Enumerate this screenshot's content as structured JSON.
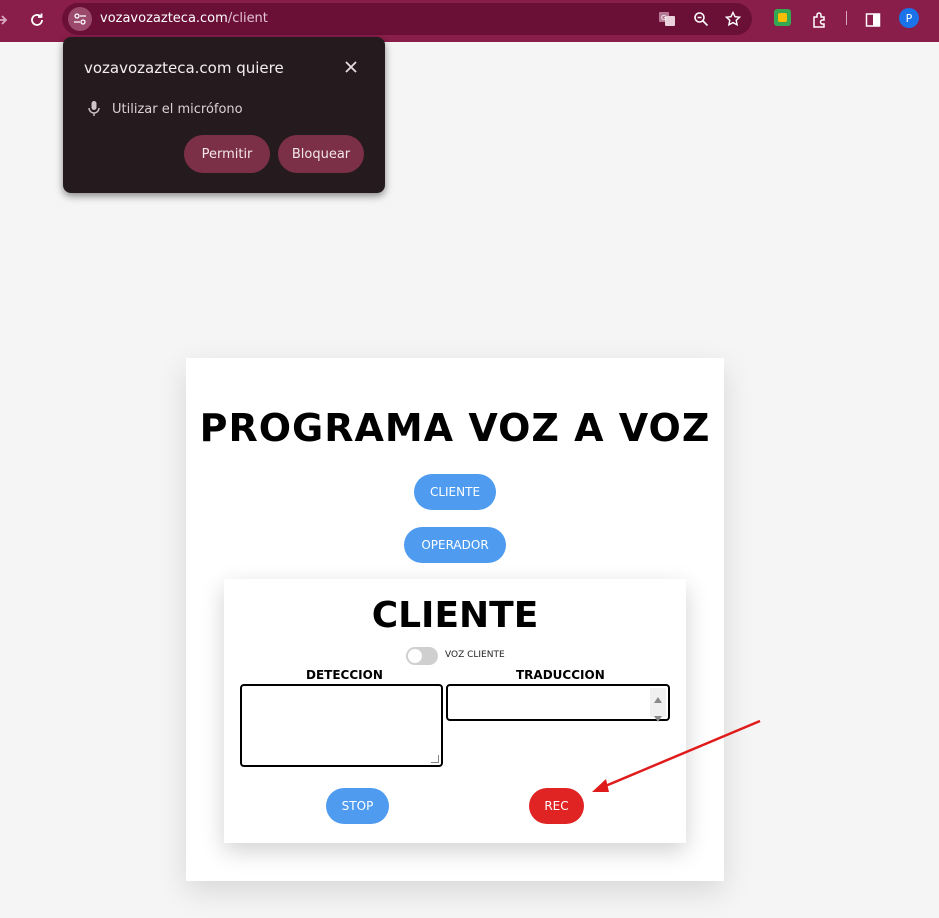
{
  "browser": {
    "url_host": "vozavozazteca.com",
    "url_path": "/client",
    "profile_initial": "P"
  },
  "permission_prompt": {
    "title": "vozavozazteca.com quiere",
    "permission_text": "Utilizar el micrófono",
    "allow_label": "Permitir",
    "block_label": "Bloquear"
  },
  "page": {
    "title": "PROGRAMA VOZ A VOZ",
    "cliente_button": "CLIENTE",
    "operador_button": "OPERADOR",
    "panel": {
      "title": "CLIENTE",
      "toggle_label": "VOZ CLIENTE",
      "deteccion_label": "DETECCION",
      "traduccion_label": "TRADUCCION",
      "deteccion_value": "",
      "traduccion_value": "",
      "stop_label": "STOP",
      "rec_label": "REC"
    }
  },
  "colors": {
    "toolbar": "#8a1e4a",
    "pill_blue": "#4e9bf0",
    "rec_red": "#e02424",
    "popup_bg": "#251b1e",
    "popup_button": "#7c3048",
    "annotation_arrow": "#e01b1b"
  }
}
